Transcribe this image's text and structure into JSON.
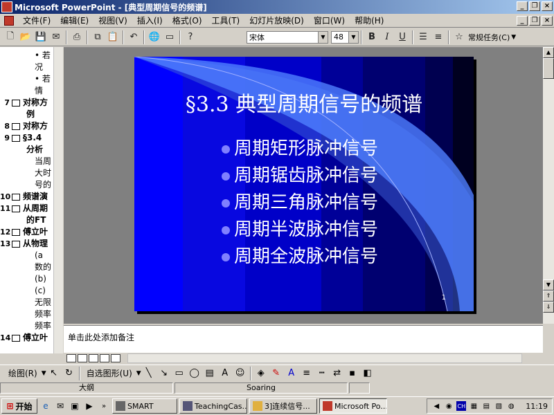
{
  "window": {
    "title": "Microsoft PowerPoint - [典型周期信号的频谱]",
    "buttons": [
      "_",
      "❐",
      "×"
    ]
  },
  "menu": {
    "items": [
      "文件(F)",
      "编辑(E)",
      "视图(V)",
      "插入(I)",
      "格式(O)",
      "工具(T)",
      "幻灯片放映(D)",
      "窗口(W)",
      "帮助(H)"
    ]
  },
  "toolbar": {
    "font_name": "宋体",
    "font_size": "48",
    "bold": "B",
    "italic": "I",
    "underline": "U",
    "tasks_label": "常规任务(C)"
  },
  "outline": {
    "rows": [
      {
        "num": "",
        "text": "• 若",
        "bold": false,
        "indent": true
      },
      {
        "num": "",
        "text": "况",
        "bold": false,
        "indent": true
      },
      {
        "num": "",
        "text": "• 若",
        "bold": false,
        "indent": true
      },
      {
        "num": "",
        "text": "情",
        "bold": false,
        "indent": true
      },
      {
        "num": "7",
        "text": "对称方",
        "bold": true,
        "indent": false
      },
      {
        "num": "",
        "text": "例",
        "bold": true,
        "indent": false
      },
      {
        "num": "8",
        "text": "对称方",
        "bold": true,
        "indent": false
      },
      {
        "num": "9",
        "text": "§3.4",
        "bold": true,
        "indent": false
      },
      {
        "num": "",
        "text": "分析",
        "bold": true,
        "indent": false
      },
      {
        "num": "",
        "text": "当周",
        "bold": false,
        "indent": true
      },
      {
        "num": "",
        "text": "大时",
        "bold": false,
        "indent": true
      },
      {
        "num": "",
        "text": "号的",
        "bold": false,
        "indent": true
      },
      {
        "num": "10",
        "text": "频谱演",
        "bold": true,
        "indent": false
      },
      {
        "num": "11",
        "text": "从周期",
        "bold": true,
        "indent": false
      },
      {
        "num": "",
        "text": "的FT",
        "bold": true,
        "indent": false
      },
      {
        "num": "12",
        "text": "傅立叶",
        "bold": true,
        "indent": false
      },
      {
        "num": "13",
        "text": "从物理",
        "bold": true,
        "indent": false
      },
      {
        "num": "",
        "text": "(a",
        "bold": false,
        "indent": true
      },
      {
        "num": "",
        "text": "数的",
        "bold": false,
        "indent": true
      },
      {
        "num": "",
        "text": "(b)",
        "bold": false,
        "indent": true
      },
      {
        "num": "",
        "text": "(c)",
        "bold": false,
        "indent": true
      },
      {
        "num": "",
        "text": "无限",
        "bold": false,
        "indent": true
      },
      {
        "num": "",
        "text": "频率",
        "bold": false,
        "indent": true
      },
      {
        "num": "",
        "text": "频率",
        "bold": false,
        "indent": true
      },
      {
        "num": "14",
        "text": "傅立叶",
        "bold": true,
        "indent": false
      }
    ]
  },
  "slide": {
    "title": "§3.3 典型周期信号的频谱",
    "bullets": [
      "周期矩形脉冲信号",
      "周期锯齿脉冲信号",
      "周期三角脉冲信号",
      "周期半波脉冲信号",
      "周期全波脉冲信号"
    ],
    "number": "1"
  },
  "notes": {
    "placeholder": "单击此处添加备注"
  },
  "drawbar": {
    "draw_label": "绘图(R)",
    "autoshape_label": "自选图形(U)"
  },
  "status": {
    "view": "大纲",
    "design": "Soaring"
  },
  "taskbar": {
    "start": "开始",
    "tasks": [
      "SMART",
      "TeachingCas...",
      "3]连续信号...",
      "Microsoft Po..."
    ],
    "clock": "11:19"
  },
  "colors": {
    "slide_stripes": [
      "#0000ff",
      "#0808e0",
      "#0000c8",
      "#000098",
      "#000070",
      "#000050",
      "#000020"
    ],
    "accent_wedge": "#4f7fff",
    "bullet_dot": "#8080ff"
  }
}
